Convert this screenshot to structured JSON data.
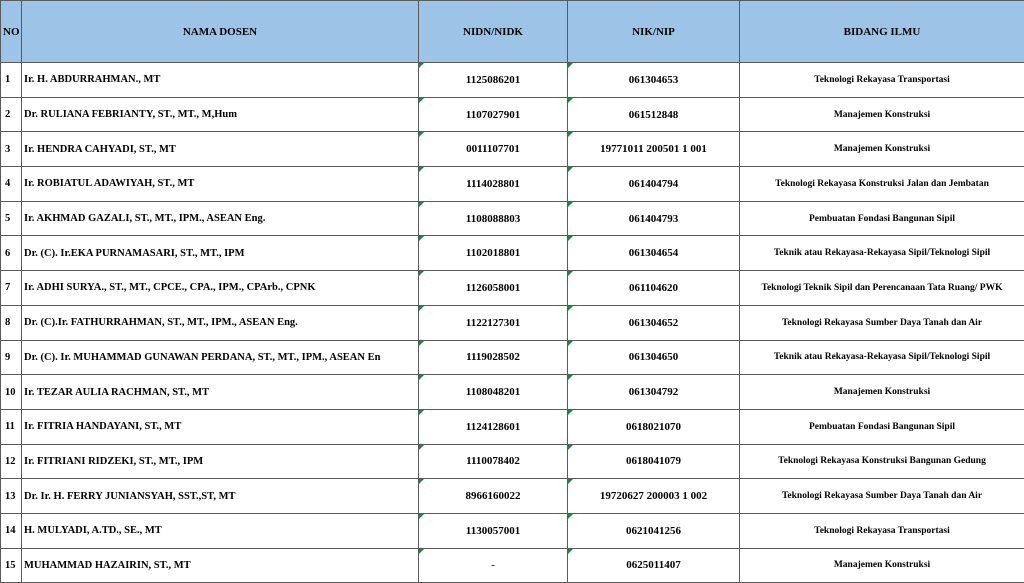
{
  "headers": {
    "no": "NO",
    "nama": "NAMA DOSEN",
    "nidn": "NIDN/NIDK",
    "nik": "NIK/NIP",
    "bidang": "BIDANG ILMU"
  },
  "rows": [
    {
      "no": "1",
      "nama": "Ir. H. ABDURRAHMAN., MT",
      "nidn": "1125086201",
      "nik": "061304653",
      "bidang": "Teknologi Rekayasa Transportasi"
    },
    {
      "no": "2",
      "nama": "Dr. RULIANA FEBRIANTY, ST., MT., M,Hum",
      "nidn": "1107027901",
      "nik": "061512848",
      "bidang": "Manajemen Konstruksi"
    },
    {
      "no": "3",
      "nama": "Ir. HENDRA CAHYADI, ST., MT",
      "nidn": "0011107701",
      "nik": "19771011 200501 1 001",
      "bidang": "Manajemen Konstruksi"
    },
    {
      "no": "4",
      "nama": "Ir. ROBIATUL ADAWIYAH, ST., MT",
      "nidn": "1114028801",
      "nik": "061404794",
      "bidang": "Teknologi Rekayasa Konstruksi Jalan dan Jembatan"
    },
    {
      "no": "5",
      "nama": "Ir. AKHMAD GAZALI, ST., MT., IPM., ASEAN Eng.",
      "nidn": "1108088803",
      "nik": "061404793",
      "bidang": "Pembuatan Fondasi Bangunan Sipil"
    },
    {
      "no": "6",
      "nama": "Dr. (C). Ir.EKA PURNAMASARI, ST., MT., IPM",
      "nidn": "1102018801",
      "nik": "061304654",
      "bidang": "Teknik atau Rekayasa-Rekayasa  Sipil/Teknologi Sipil"
    },
    {
      "no": "7",
      "nama": "Ir. ADHI SURYA., ST., MT., CPCE., CPA., IPM., CPArb., CPNK",
      "nidn": "1126058001",
      "nik": "061104620",
      "bidang": "Teknologi Teknik Sipil dan Perencanaan Tata Ruang/ PWK"
    },
    {
      "no": "8",
      "nama": "Dr. (C).Ir. FATHURRAHMAN, ST., MT., IPM., ASEAN Eng.",
      "nidn": "1122127301",
      "nik": "061304652",
      "bidang": "Teknologi Rekayasa Sumber Daya Tanah dan Air"
    },
    {
      "no": "9",
      "nama": "Dr. (C). Ir. MUHAMMAD GUNAWAN PERDANA, ST., MT., IPM., ASEAN En",
      "nidn": "1119028502",
      "nik": "061304650",
      "bidang": "Teknik atau Rekayasa-Rekayasa  Sipil/Teknologi Sipil"
    },
    {
      "no": "10",
      "nama": "Ir. TEZAR AULIA RACHMAN, ST., MT",
      "nidn": "1108048201",
      "nik": "061304792",
      "bidang": "Manajemen Konstruksi"
    },
    {
      "no": "11",
      "nama": "Ir. FITRIA HANDAYANI, ST., MT",
      "nidn": "1124128601",
      "nik": "0618021070",
      "bidang": "Pembuatan Fondasi Bangunan Sipil"
    },
    {
      "no": "12",
      "nama": "Ir. FITRIANI RIDZEKI, ST., MT., IPM",
      "nidn": "1110078402",
      "nik": "0618041079",
      "bidang": "Teknologi Rekayasa Konstruksi Bangunan Gedung"
    },
    {
      "no": "13",
      "nama": "Dr. Ir. H. FERRY JUNIANSYAH, SST.,ST, MT",
      "nidn": "8966160022",
      "nik": "19720627 200003 1 002",
      "bidang": "Teknologi Rekayasa Sumber Daya Tanah dan Air"
    },
    {
      "no": "14",
      "nama": "H. MULYADI, A.TD., SE., MT",
      "nidn": "1130057001",
      "nik": "0621041256",
      "bidang": "Teknologi Rekayasa Transportasi"
    },
    {
      "no": "15",
      "nama": "MUHAMMAD HAZAIRIN, ST., MT",
      "nidn": "-",
      "nik": "0625011407",
      "bidang": "Manajemen Konstruksi"
    }
  ],
  "colors": {
    "header_bg": "#9dc3e6",
    "grid_line": "#5a5a5a",
    "cell_marker": "#1a8a3a"
  }
}
